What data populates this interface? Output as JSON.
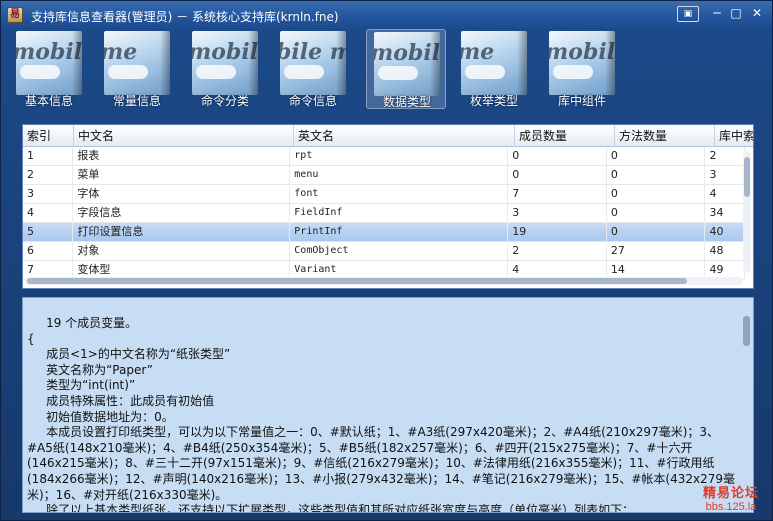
{
  "window": {
    "title": "支持库信息查看器(管理员) － 系统核心支持库(krnln.fne)",
    "menu_glyph": "▣",
    "minimize_glyph": "─",
    "maximize_glyph": "□",
    "close_glyph": "✕"
  },
  "toolbar": {
    "items": [
      {
        "label": "基本信息",
        "brand": "mobile",
        "active": false
      },
      {
        "label": "常量信息",
        "brand": "me",
        "active": false
      },
      {
        "label": "命令分类",
        "brand": "mobile",
        "active": false
      },
      {
        "label": "命令信息",
        "brand": "bile me",
        "active": false
      },
      {
        "label": "数据类型",
        "brand": "mobile",
        "active": true
      },
      {
        "label": "枚举类型",
        "brand": "me",
        "active": false
      },
      {
        "label": "库中组件",
        "brand": "mobile me",
        "active": false
      }
    ]
  },
  "grid": {
    "columns": [
      "索引",
      "中文名",
      "英文名",
      "成员数量",
      "方法数量",
      "库中索"
    ],
    "rows": [
      [
        "1",
        "报表",
        "rpt",
        "0",
        "0",
        "2"
      ],
      [
        "2",
        "菜单",
        "menu",
        "0",
        "0",
        "3"
      ],
      [
        "3",
        "字体",
        "font",
        "7",
        "0",
        "4"
      ],
      [
        "4",
        "字段信息",
        "FieldInf",
        "3",
        "0",
        "34"
      ],
      [
        "5",
        "打印设置信息",
        "PrintInf",
        "19",
        "0",
        "40"
      ],
      [
        "6",
        "对象",
        "ComObject",
        "2",
        "27",
        "48"
      ],
      [
        "7",
        "变体型",
        "Variant",
        "4",
        "14",
        "49"
      ]
    ],
    "selected_row_index": 4
  },
  "detail": {
    "text": "     19 个成员变量。\n{\n     成员<1>的中文名称为“纸张类型”\n     英文名称为“Paper”\n     类型为“int(int)”\n     成员特殊属性：此成员有初始值\n     初始值数据地址为：0。\n     本成员设置打印纸类型，可以为以下常量值之一：0、#默认纸；1、#A3纸(297x420毫米)；2、#A4纸(210x297毫米)；3、#A5纸(148x210毫米)；4、#B4纸(250x354毫米)；5、#B5纸(182x257毫米)；6、#四开(215x275毫米)；7、#十六开(146x215毫米)；8、#三十二开(97x151毫米)；9、#信纸(216x279毫米)；10、#法律用纸(216x355毫米)；11、#行政用纸(184x266毫米)；12、#声明(140x216毫米)；13、#小报(279x432毫米)；14、#笔记(216x279毫米)；15、#帐本(432x279毫米)；16、#对开纸(216x330毫米)。\n     除了以上基本类型纸张，还支持以下扩展类型，这些类型值和其所对应纸张宽度与高度（单位毫米）列表如下："
  },
  "watermark": {
    "line1": "精易论坛",
    "line2": "bbs.125.la"
  },
  "colors": {
    "window_bg": "#1c4a8a",
    "selected_row": "#b4cfef",
    "detail_bg": "#c6ddf3",
    "watermark": "#e03b2b"
  }
}
